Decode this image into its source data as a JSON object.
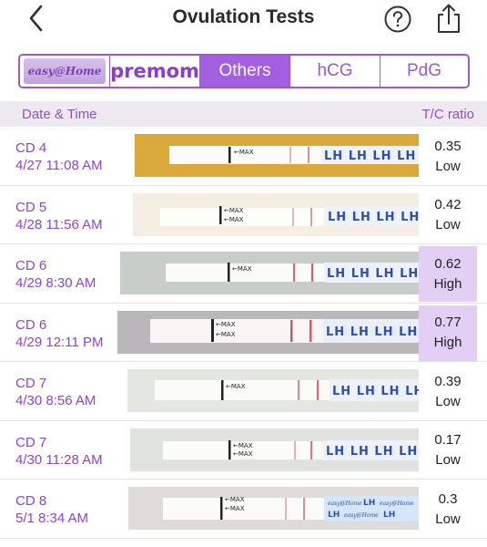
{
  "nav": {
    "title": "Ovulation Tests",
    "back_icon": "chevron-left-icon",
    "help_icon": "question-circle-icon",
    "share_icon": "share-icon"
  },
  "segments": {
    "brand1_label": "easy@Home",
    "brand2_label": "premom",
    "others_label": "Others",
    "hcg_label": "hCG",
    "pdg_label": "PdG"
  },
  "table": {
    "col_date": "Date & Time",
    "col_ratio": "T/C ratio"
  },
  "rows": [
    {
      "cd": "CD 4",
      "datetime": "4/27 11:08 AM",
      "ratio": "0.35",
      "level": "Low"
    },
    {
      "cd": "CD 5",
      "datetime": "4/28 11:56 AM",
      "ratio": "0.42",
      "level": "Low"
    },
    {
      "cd": "CD 6",
      "datetime": "4/29 8:30 AM",
      "ratio": "0.62",
      "level": "High"
    },
    {
      "cd": "CD 6",
      "datetime": "4/29 12:11 PM",
      "ratio": "0.77",
      "level": "High"
    },
    {
      "cd": "CD 7",
      "datetime": "4/30 8:56 AM",
      "ratio": "0.39",
      "level": "Low"
    },
    {
      "cd": "CD 7",
      "datetime": "4/30 11:28 AM",
      "ratio": "0.17",
      "level": "Low"
    },
    {
      "cd": "CD 8",
      "datetime": "5/1 8:34 AM",
      "ratio": "0.3",
      "level": "Low"
    }
  ],
  "strip_text": {
    "max": "←MAX",
    "lh": "LH",
    "brand": "easy@Home"
  },
  "colors": {
    "accent": "#9b59d0",
    "active_bg": "#a35ee1",
    "highlight": "#e3cff5",
    "link_text": "#8f45c8"
  }
}
